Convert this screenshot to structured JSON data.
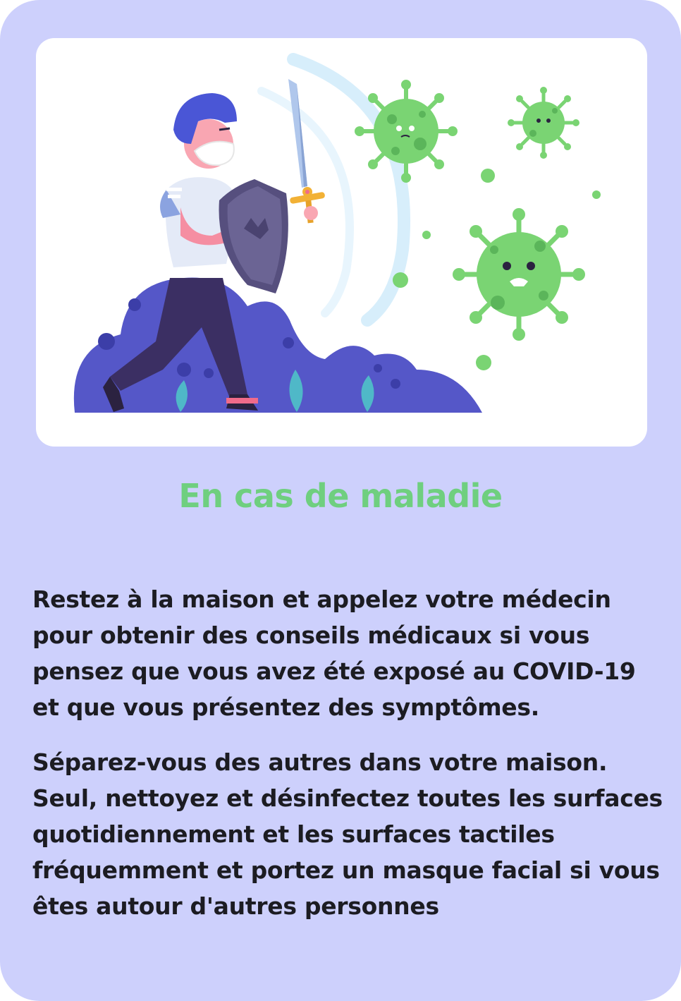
{
  "card": {
    "illustration": {
      "icons": [
        "person-with-mask",
        "sword-icon",
        "shield-icon",
        "virus-icon",
        "bush-icon"
      ],
      "colors": {
        "card_background": "#cdd0fc",
        "virus_green": "#7ad473",
        "bush_blue": "#5557c8",
        "leaf_teal": "#4fb8c8"
      }
    },
    "title": "En cas de maladie",
    "paragraphs": [
      "Restez à la maison et appelez votre médecin pour obtenir des conseils médicaux si vous pensez que vous avez été exposé au COVID-19 et que vous présentez des symptômes.",
      "Séparez-vous des autres dans votre maison. Seul, nettoyez et désinfectez toutes les surfaces quotidiennement et les surfaces tactiles fréquemment et portez un masque facial si vous êtes autour d'autres personnes"
    ]
  }
}
